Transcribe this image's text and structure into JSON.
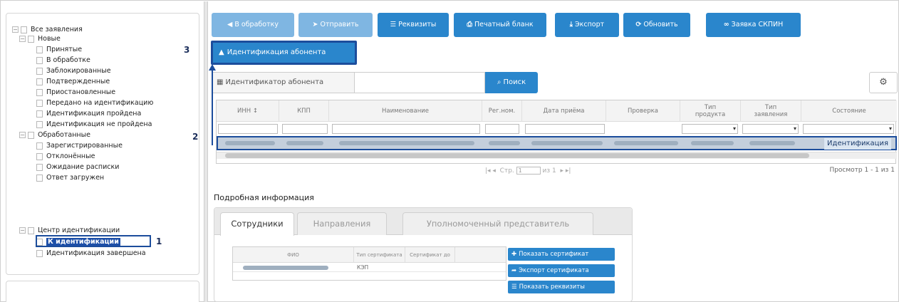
{
  "tree": {
    "root": "Все заявления",
    "groups": [
      {
        "label": "Новые",
        "items": [
          "Принятые",
          "В обработке",
          "Заблокированные",
          "Подтвержденные",
          "Приостановленные",
          "Передано на идентификацию",
          "Идентификация пройдена",
          "Идентификация не пройдена"
        ]
      },
      {
        "label": "Обработанные",
        "items": [
          "Зарегистрированные",
          "Отклонённые",
          "Ожидание расписки",
          "Ответ загружен"
        ]
      },
      {
        "label": "Центр идентификации",
        "items": [
          "К идентификации",
          "Идентификация завершена"
        ]
      }
    ],
    "selected": "К идентификации"
  },
  "markers": {
    "m1": "1",
    "m2": "2",
    "m3": "3"
  },
  "toolbar": {
    "in_work": "В обработку",
    "send": "Отправить",
    "requisites": "Реквизиты",
    "print_form": "Печатный бланк",
    "export": "Экспорт",
    "refresh": "Обновить",
    "skpin_request": "Заявка СКПИН",
    "ident_button": "Идентификация абонента"
  },
  "search": {
    "label": "Идентификатор абонента",
    "button": "Поиск"
  },
  "grid": {
    "columns": [
      "ИНН",
      "КПП",
      "Наименование",
      "Рег.ном.",
      "Дата приёма",
      "Проверка",
      "Тип продукта",
      "Тип заявления",
      "Состояние"
    ],
    "row_state": "Идентификация",
    "pager_page": "Стр.",
    "pager_page_value": "1",
    "pager_of": "из 1",
    "pager_view": "Просмотр 1 - 1 из 1"
  },
  "detail": {
    "title": "Подробная информация",
    "tabs": [
      "Сотрудники",
      "Направления",
      "Уполномоченный представитель"
    ],
    "table": {
      "columns": [
        "ФИО",
        "Тип сертификата",
        "Сертификат до"
      ],
      "row": {
        "cert_type": "КЭП"
      }
    },
    "actions": [
      "Показать сертификат",
      "Экспорт сертификата",
      "Показать реквизиты"
    ]
  },
  "colors": {
    "accent": "#2a86cc",
    "highlight": "#1c4d9c",
    "disabled": "#7fb6e2"
  }
}
